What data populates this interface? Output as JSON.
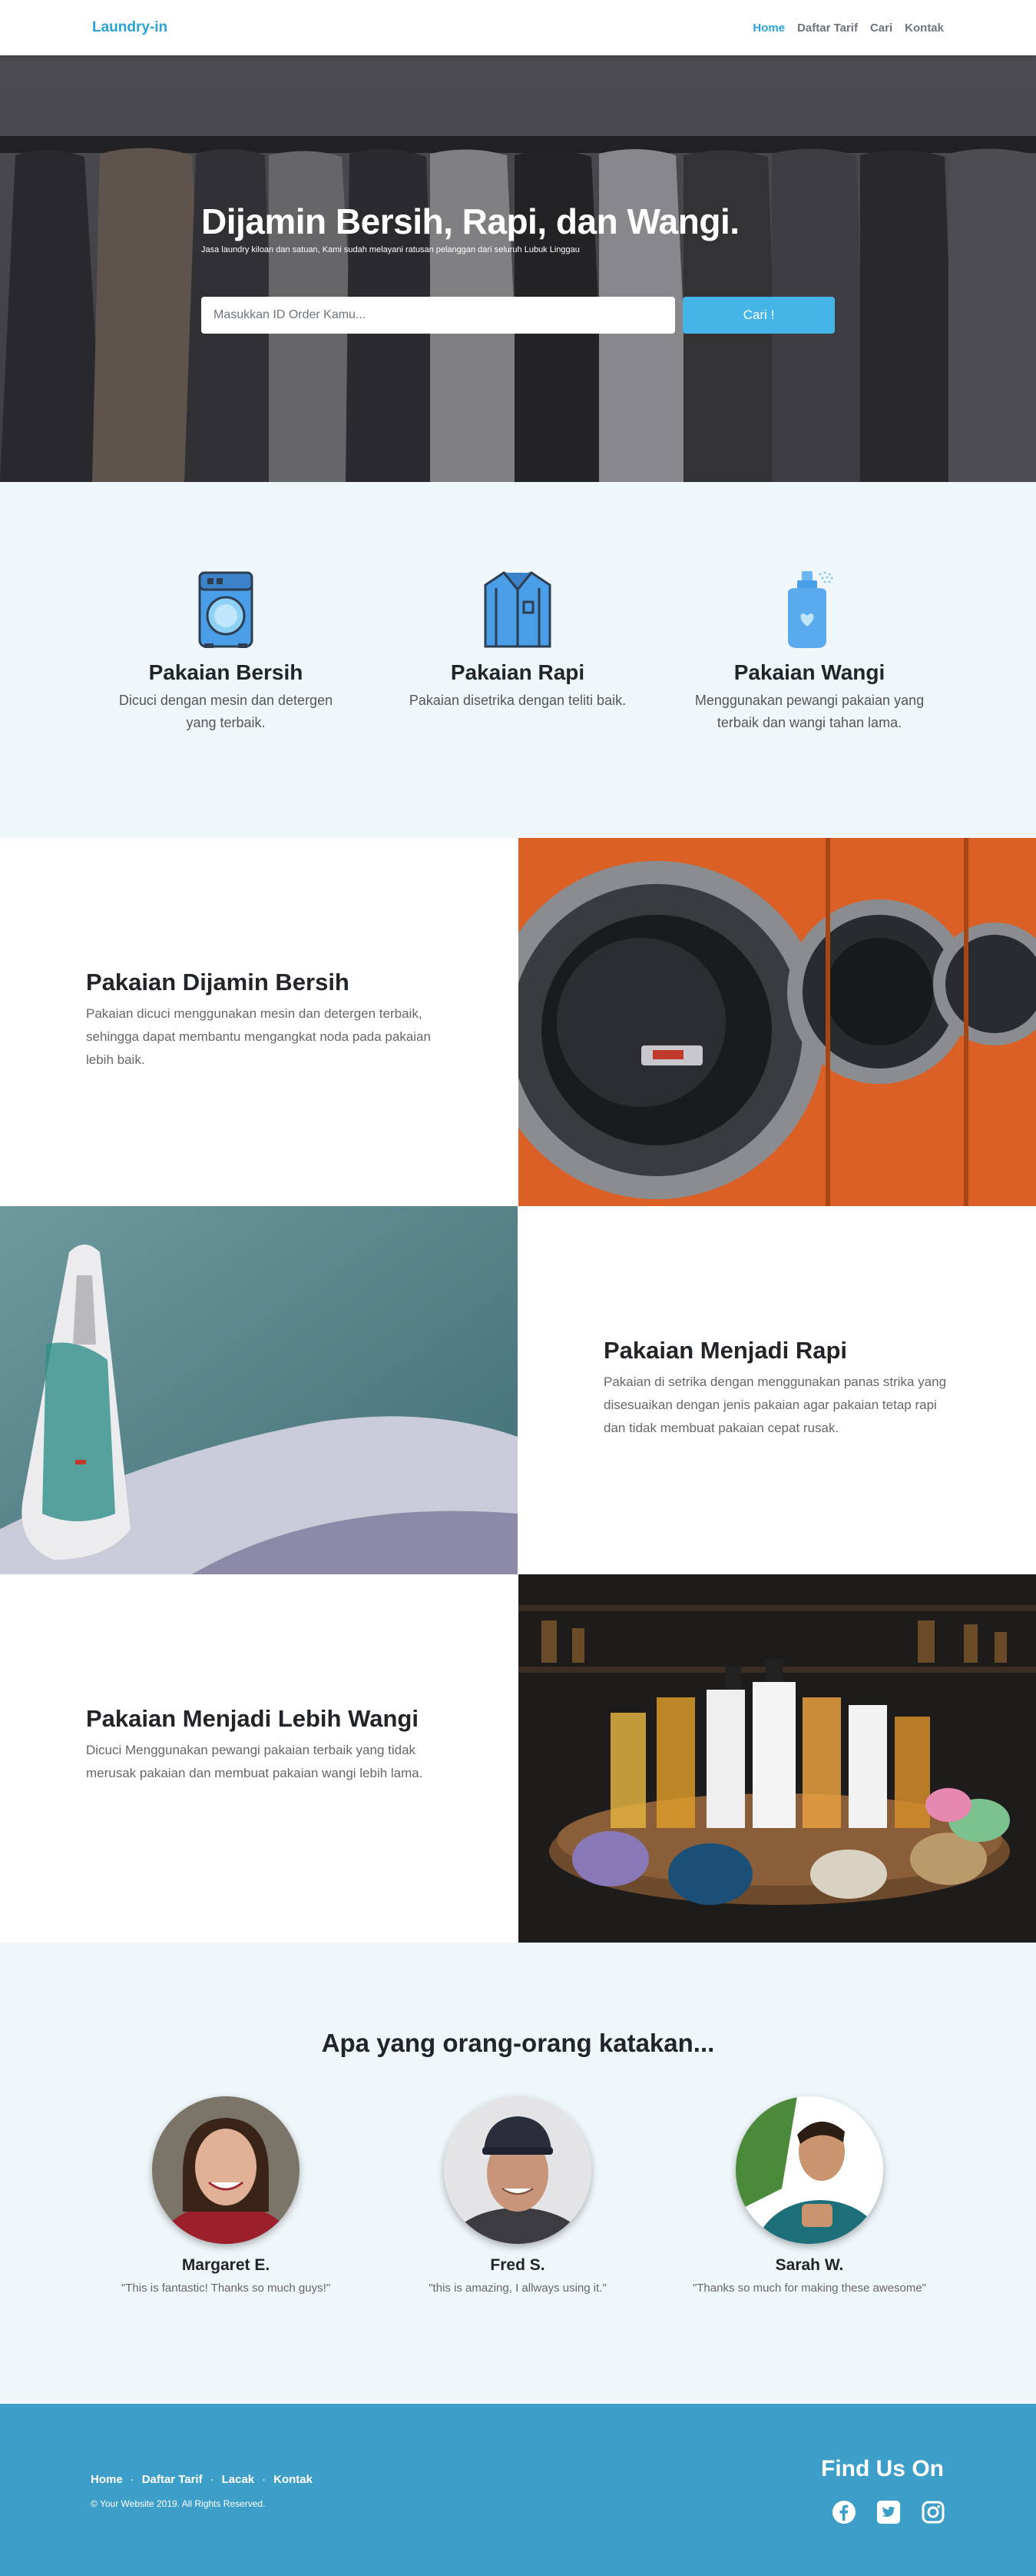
{
  "nav": {
    "brand": "Laundry-in",
    "links": [
      {
        "label": "Home",
        "active": true
      },
      {
        "label": "Daftar Tarif",
        "active": false
      },
      {
        "label": "Cari",
        "active": false
      },
      {
        "label": "Kontak",
        "active": false
      }
    ]
  },
  "hero": {
    "title": "Dijamin Bersih, Rapi, dan Wangi.",
    "subtitle": "Jasa laundry kiloan dan satuan, Kami sudah melayani ratusan pelanggan dari seluruh Lubuk Linggau",
    "search_placeholder": "Masukkan ID Order Kamu...",
    "search_button": "Cari !"
  },
  "features": [
    {
      "icon": "washing-machine-icon",
      "title": "Pakaian Bersih",
      "text": "Dicuci dengan mesin dan detergen yang terbaik."
    },
    {
      "icon": "shirt-icon",
      "title": "Pakaian Rapi",
      "text": "Pakaian disetrika dengan teliti baik."
    },
    {
      "icon": "perfume-bottle-icon",
      "title": "Pakaian Wangi",
      "text": "Menggunakan pewangi pakaian yang terbaik dan wangi tahan lama."
    }
  ],
  "showcase": [
    {
      "title": "Pakaian Dijamin Bersih",
      "text": "Pakaian dicuci menggunakan mesin dan detergen terbaik, sehingga dapat membantu mengangkat noda pada pakaian lebih baik.",
      "image": "washing-machines-photo"
    },
    {
      "title": "Pakaian Menjadi Rapi",
      "text": "Pakaian di setrika dengan menggunakan panas strika yang disesuaikan dengan jenis pakaian agar pakaian tetap rapi dan tidak membuat pakaian cepat rusak.",
      "image": "iron-photo"
    },
    {
      "title": "Pakaian Menjadi Lebih Wangi",
      "text": "Dicuci Menggunakan pewangi pakaian terbaik yang tidak merusak pakaian dan membuat pakaian wangi lebih lama.",
      "image": "perfume-bottles-photo"
    }
  ],
  "testimonials": {
    "heading": "Apa yang orang-orang katakan...",
    "items": [
      {
        "name": "Margaret E.",
        "quote": "\"This is fantastic! Thanks so much guys!\""
      },
      {
        "name": "Fred S.",
        "quote": "\"this is amazing, I allways using it.\""
      },
      {
        "name": "Sarah W.",
        "quote": "\"Thanks so much for making these awesome\""
      }
    ]
  },
  "footer": {
    "links": [
      "Home",
      "Daftar Tarif",
      "Lacak",
      "Kontak"
    ],
    "separator": "·",
    "copyright": "© Your Website 2019. All Rights Reserved.",
    "find_us": "Find Us On",
    "socials": [
      "facebook-icon",
      "twitter-icon",
      "instagram-icon"
    ]
  },
  "colors": {
    "accent": "#2aa3d8",
    "button": "#45b5e8",
    "footer_bg": "#3d9fc8",
    "section_bg": "#eff7fa"
  }
}
